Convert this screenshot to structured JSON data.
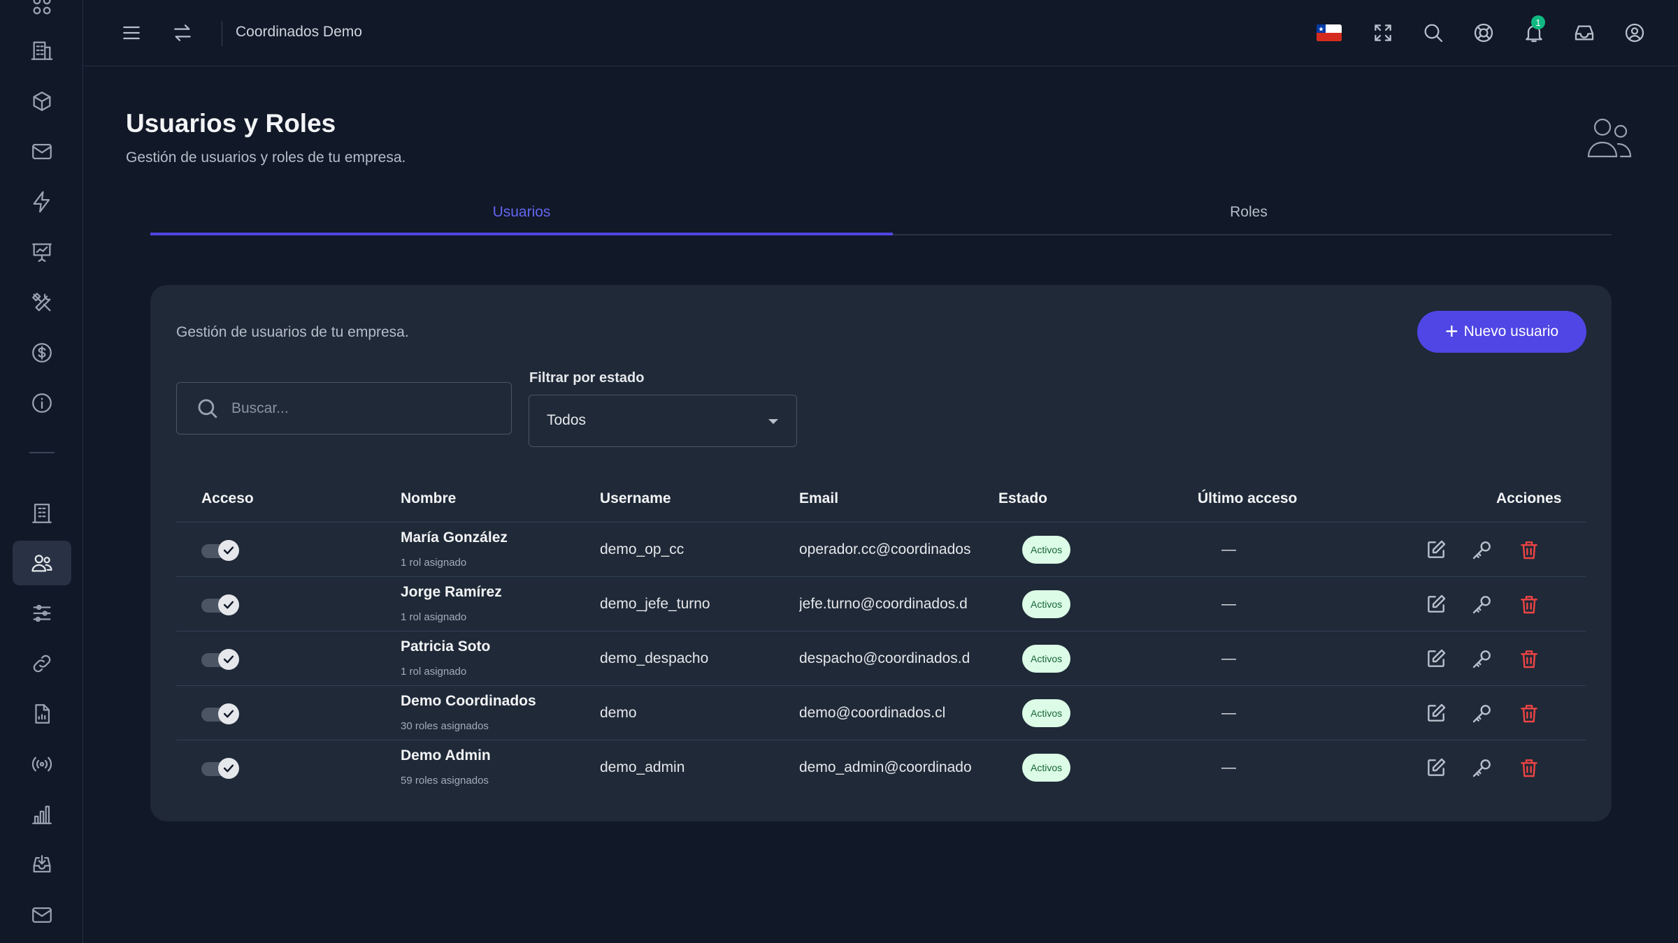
{
  "app": {
    "title": "Coordinados Demo"
  },
  "page": {
    "title": "Usuarios y Roles",
    "subtitle": "Gestión de usuarios y roles de tu empresa."
  },
  "tabs": [
    {
      "label": "Usuarios",
      "active": true
    },
    {
      "label": "Roles",
      "active": false
    }
  ],
  "card": {
    "description": "Gestión de usuarios de tu empresa.",
    "new_button_label": "Nuevo usuario",
    "search_placeholder": "Buscar...",
    "filter_label": "Filtrar por estado",
    "filter_value": "Todos"
  },
  "notifications": {
    "count": "1"
  },
  "table": {
    "headers": {
      "access": "Acceso",
      "name": "Nombre",
      "username": "Username",
      "email": "Email",
      "status": "Estado",
      "last_access": "Último acceso",
      "actions": "Acciones"
    },
    "rows": [
      {
        "name": "María González",
        "roles": "1 rol asignado",
        "username": "demo_op_cc",
        "email": "operador.cc@coordinados",
        "status": "Activos",
        "last_access": "—",
        "access": true
      },
      {
        "name": "Jorge Ramírez",
        "roles": "1 rol asignado",
        "username": "demo_jefe_turno",
        "email": "jefe.turno@coordinados.d",
        "status": "Activos",
        "last_access": "—",
        "access": true
      },
      {
        "name": "Patricia Soto",
        "roles": "1 rol asignado",
        "username": "demo_despacho",
        "email": "despacho@coordinados.d",
        "status": "Activos",
        "last_access": "—",
        "access": true
      },
      {
        "name": "Demo Coordinados",
        "roles": "30 roles asignados",
        "username": "demo",
        "email": "demo@coordinados.cl",
        "status": "Activos",
        "last_access": "—",
        "access": true
      },
      {
        "name": "Demo Admin",
        "roles": "59 roles asignados",
        "username": "demo_admin",
        "email": "demo_admin@coordinado",
        "status": "Activos",
        "last_access": "—",
        "access": true
      }
    ]
  },
  "sidebar": {
    "items": [
      {
        "icon": "apps-icon"
      },
      {
        "icon": "building-icon"
      },
      {
        "icon": "cube-icon"
      },
      {
        "icon": "mail-icon"
      },
      {
        "icon": "bolt-icon"
      },
      {
        "icon": "presentation-chart-icon"
      },
      {
        "icon": "tools-icon"
      },
      {
        "icon": "dollar-icon"
      },
      {
        "icon": "info-icon"
      },
      {
        "icon": "building-icon"
      },
      {
        "icon": "users-icon",
        "active": true
      },
      {
        "icon": "sliders-icon"
      },
      {
        "icon": "link-icon"
      },
      {
        "icon": "report-file-icon"
      },
      {
        "icon": "broadcast-icon"
      },
      {
        "icon": "bar-chart-icon"
      },
      {
        "icon": "inbox-download-icon"
      },
      {
        "icon": "mail-icon"
      }
    ]
  },
  "colors": {
    "accent": "#4f46e5",
    "status_active_bg": "#dcfce7",
    "status_active_text": "#166534",
    "danger": "#ef4444"
  }
}
